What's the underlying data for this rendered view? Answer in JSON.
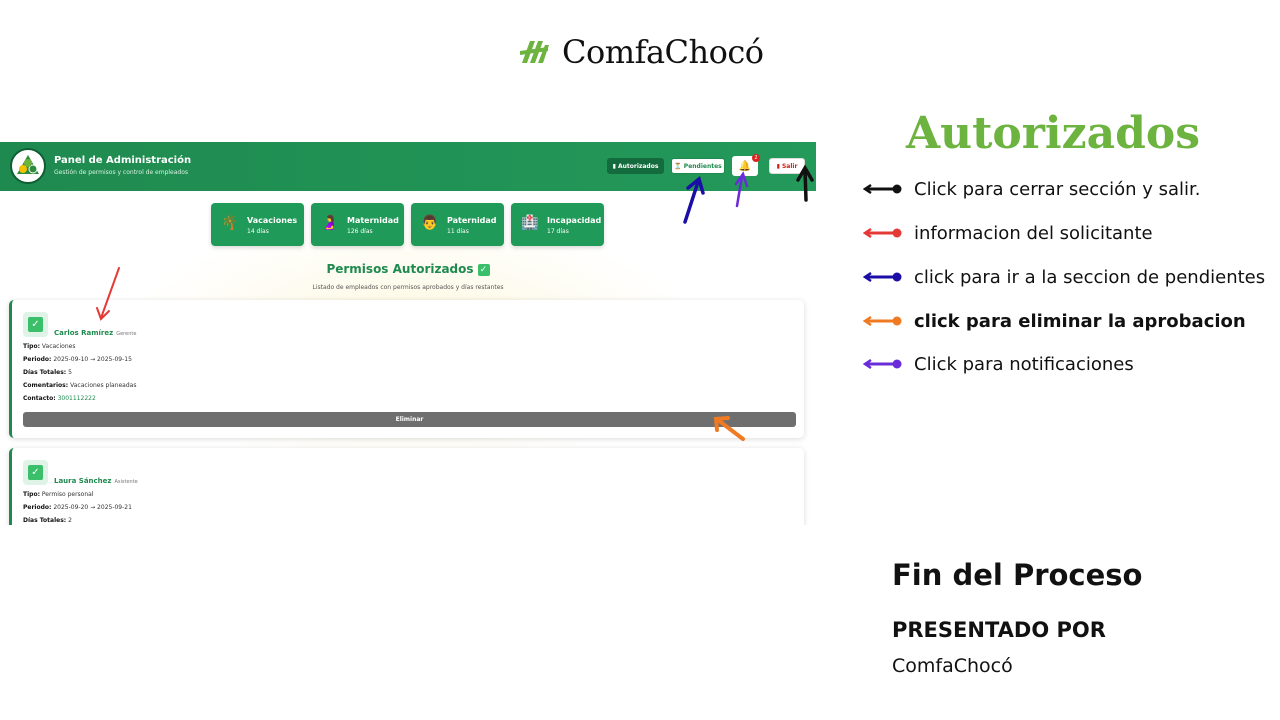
{
  "brand": {
    "name": "ComfaChocó",
    "logo_color": "#6db33f"
  },
  "app": {
    "title": "Panel de Administración",
    "subtitle": "Gestión de permisos y control de empleados",
    "nav": {
      "autorizados": "▮ Autorizados",
      "pendientes": "⏳ Pendientes",
      "bell_icon": "bell-icon",
      "notif_count": "2",
      "salir": "▮ Salir"
    },
    "stats": [
      {
        "icon": "🌴",
        "label": "Vacaciones",
        "days": "14 días"
      },
      {
        "icon": "🤰",
        "label": "Maternidad",
        "days": "126 días"
      },
      {
        "icon": "👨",
        "label": "Paternidad",
        "days": "11 días"
      },
      {
        "icon": "🏥",
        "label": "Incapacidad",
        "days": "17 días"
      }
    ],
    "section_title": "Permisos Autorizados",
    "section_subtitle": "Listado de empleados con permisos aprobados y días restantes",
    "cards": [
      {
        "name": "Carlos Ramírez",
        "role": "Gerente",
        "tipo_label": "Tipo:",
        "tipo": "Vacaciones",
        "periodo_label": "Periodo:",
        "periodo": "2025-09-10 → 2025-09-15",
        "dias_label": "Días Totales:",
        "dias": "5",
        "comentarios_label": "Comentarios:",
        "comentarios": "Vacaciones planeadas",
        "contacto_label": "Contacto:",
        "contacto": "3001112222",
        "delete_label": "Eliminar"
      },
      {
        "name": "Laura Sánchez",
        "role": "Asistente",
        "tipo_label": "Tipo:",
        "tipo": "Permiso personal",
        "periodo_label": "Periodo:",
        "periodo": "2025-09-20 → 2025-09-21",
        "dias_label": "Días Totales:",
        "dias": "2"
      }
    ]
  },
  "panel": {
    "title": "Autorizados",
    "legend": [
      {
        "color": "#111111",
        "text": "Click para cerrar sección y salir."
      },
      {
        "color": "#e53935",
        "text": "informacion del solicitante"
      },
      {
        "color": "#1a0ea6",
        "text": "click para ir a la seccion de pendientes"
      },
      {
        "color": "#f07a22",
        "text": "click para eliminar la aprobacion"
      },
      {
        "color": "#6a2bd9",
        "text": "Click para notificaciones"
      }
    ],
    "end_title": "Fin del Proceso",
    "presented_by_label": "PRESENTADO POR",
    "presented_by": "ComfaChocó"
  }
}
